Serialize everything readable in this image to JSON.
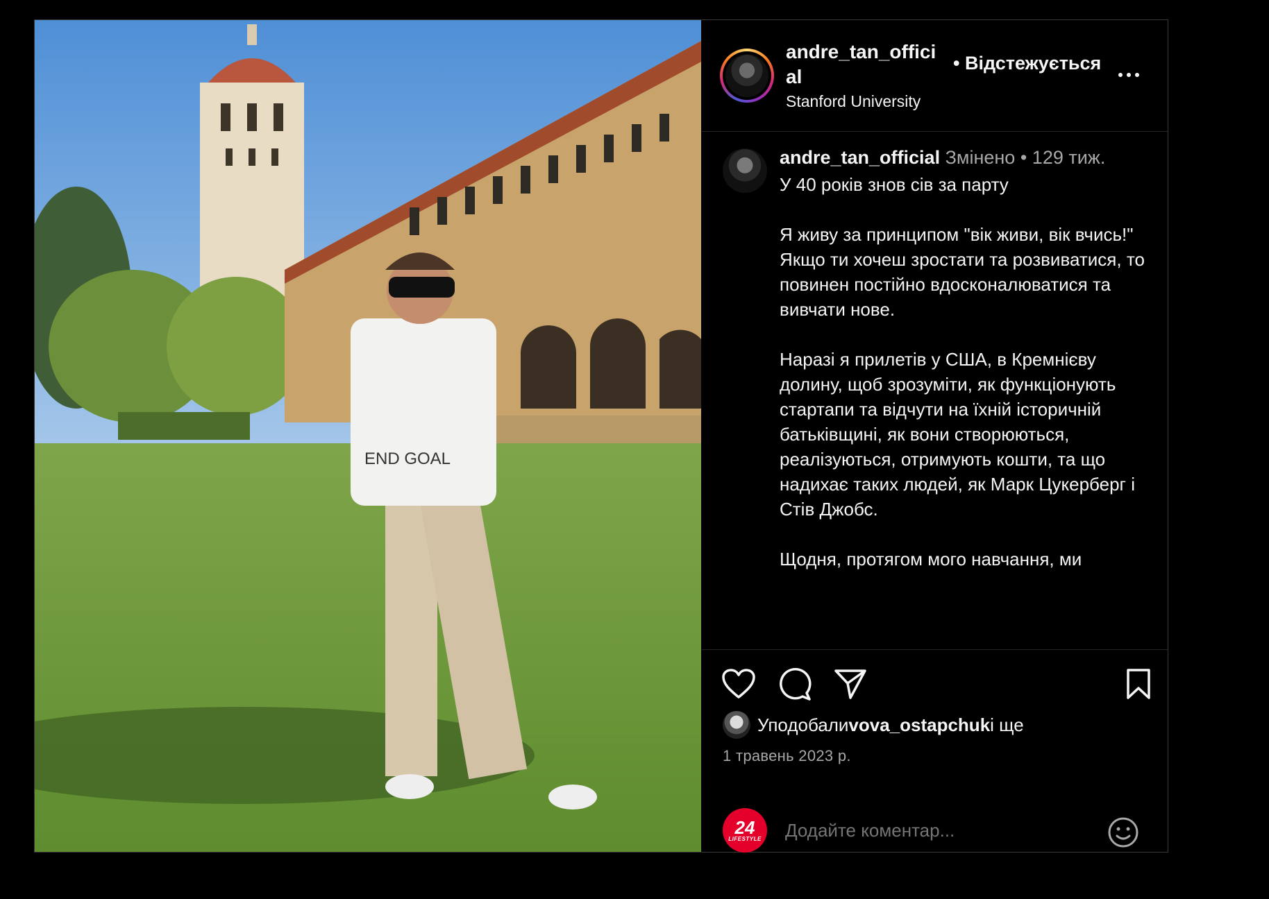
{
  "header": {
    "username": "andre_tan_official",
    "follow_label": "• Відстежується",
    "location": "Stanford University"
  },
  "caption": {
    "username": "andre_tan_official",
    "edited": "Змінено",
    "separator": " • ",
    "age": "129 тиж.",
    "text": "У 40 років знов сів за парту\n\nЯ живу за принципом \"вік живи, вік вчись!\"\nЯкщо ти хочеш зростати та розвиватися, то повинен постійно вдосконалюватися та вивчати нове.\n\nНаразі я прилетів у США, в Кремнієву долину, щоб зрозуміти, як функціонують стартапи та відчути на їхній історичній батьківщині, як вони створюються, реалізуються, отримують кошти, та що надихає таких людей, як Марк Цукерберг і Стів Джобс.\n\nЩодня, протягом мого навчання, ми"
  },
  "likes": {
    "prefix": "Уподобали ",
    "user": "vova_ostapchuk",
    "suffix": " і ще"
  },
  "date": "1 травень 2023 р.",
  "comment": {
    "placeholder": "Додайте коментар...",
    "avatar_number": "24",
    "avatar_sub": "LIFESTYLE"
  },
  "icons": [
    "heart-icon",
    "comment-icon",
    "share-icon",
    "bookmark-icon",
    "emoji-icon",
    "more-icon"
  ],
  "colors": {
    "background": "#000000",
    "text": "#f5f5f5",
    "muted": "#a8a8a8",
    "divider": "#262626",
    "avatar_badge": "#e4002b"
  }
}
